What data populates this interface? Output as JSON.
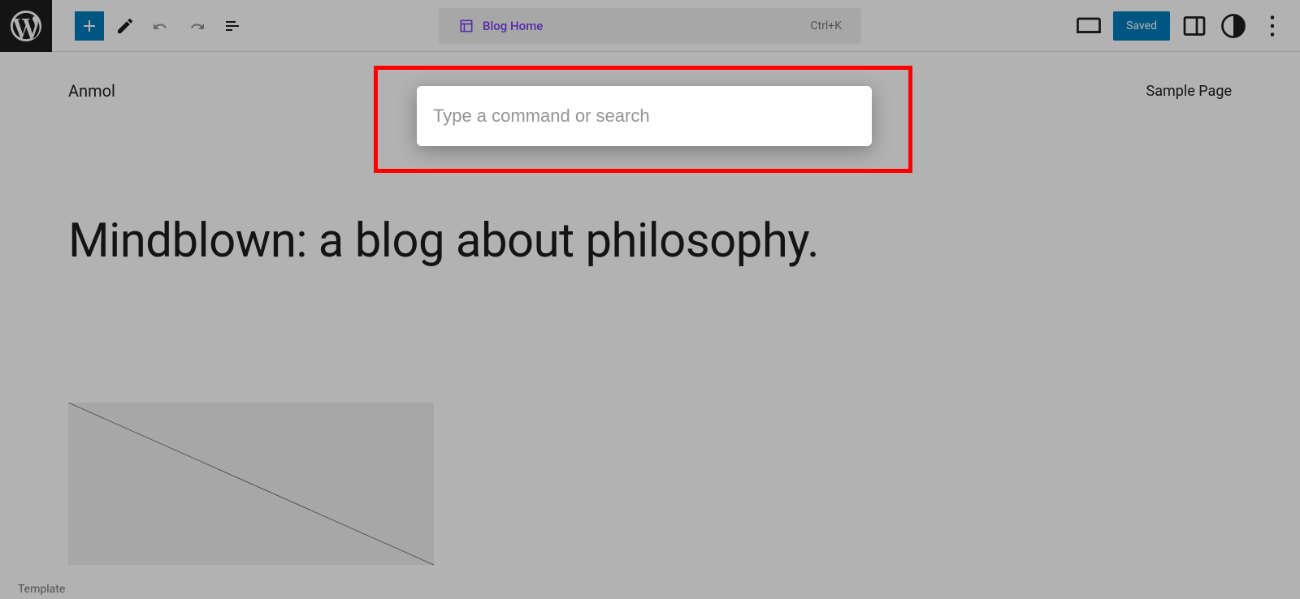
{
  "toolbar": {
    "center": {
      "title": "Blog Home",
      "shortcut": "Ctrl+K"
    },
    "right": {
      "saved_label": "Saved"
    }
  },
  "canvas": {
    "site_title": "Anmol",
    "nav_link": "Sample Page",
    "heading": "Mindblown: a blog about philosophy."
  },
  "command": {
    "placeholder": "Type a command or search"
  },
  "footer": {
    "tab": "Template"
  }
}
